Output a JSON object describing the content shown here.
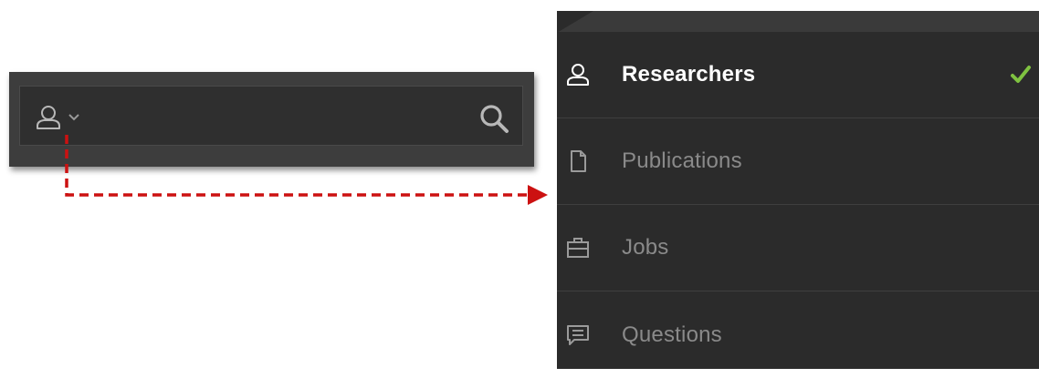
{
  "search": {
    "scope_icon": "user-icon",
    "scope_chevron_icon": "chevron-down-icon",
    "search_icon": "search-icon"
  },
  "menu": {
    "items": [
      {
        "label": "Researchers",
        "icon": "user-icon",
        "selected": true
      },
      {
        "label": "Publications",
        "icon": "document-icon",
        "selected": false
      },
      {
        "label": "Jobs",
        "icon": "briefcase-icon",
        "selected": false
      },
      {
        "label": "Questions",
        "icon": "speech-bubble-icon",
        "selected": false
      }
    ],
    "selected_check_icon": "check-icon"
  },
  "colors": {
    "panel_bg": "#2b2b2b",
    "search_bg": "#3d3d3d",
    "label_active": "#ffffff",
    "label_inactive": "#8a8a8a",
    "check_green": "#7fc241",
    "connector_red": "#cc1111"
  }
}
